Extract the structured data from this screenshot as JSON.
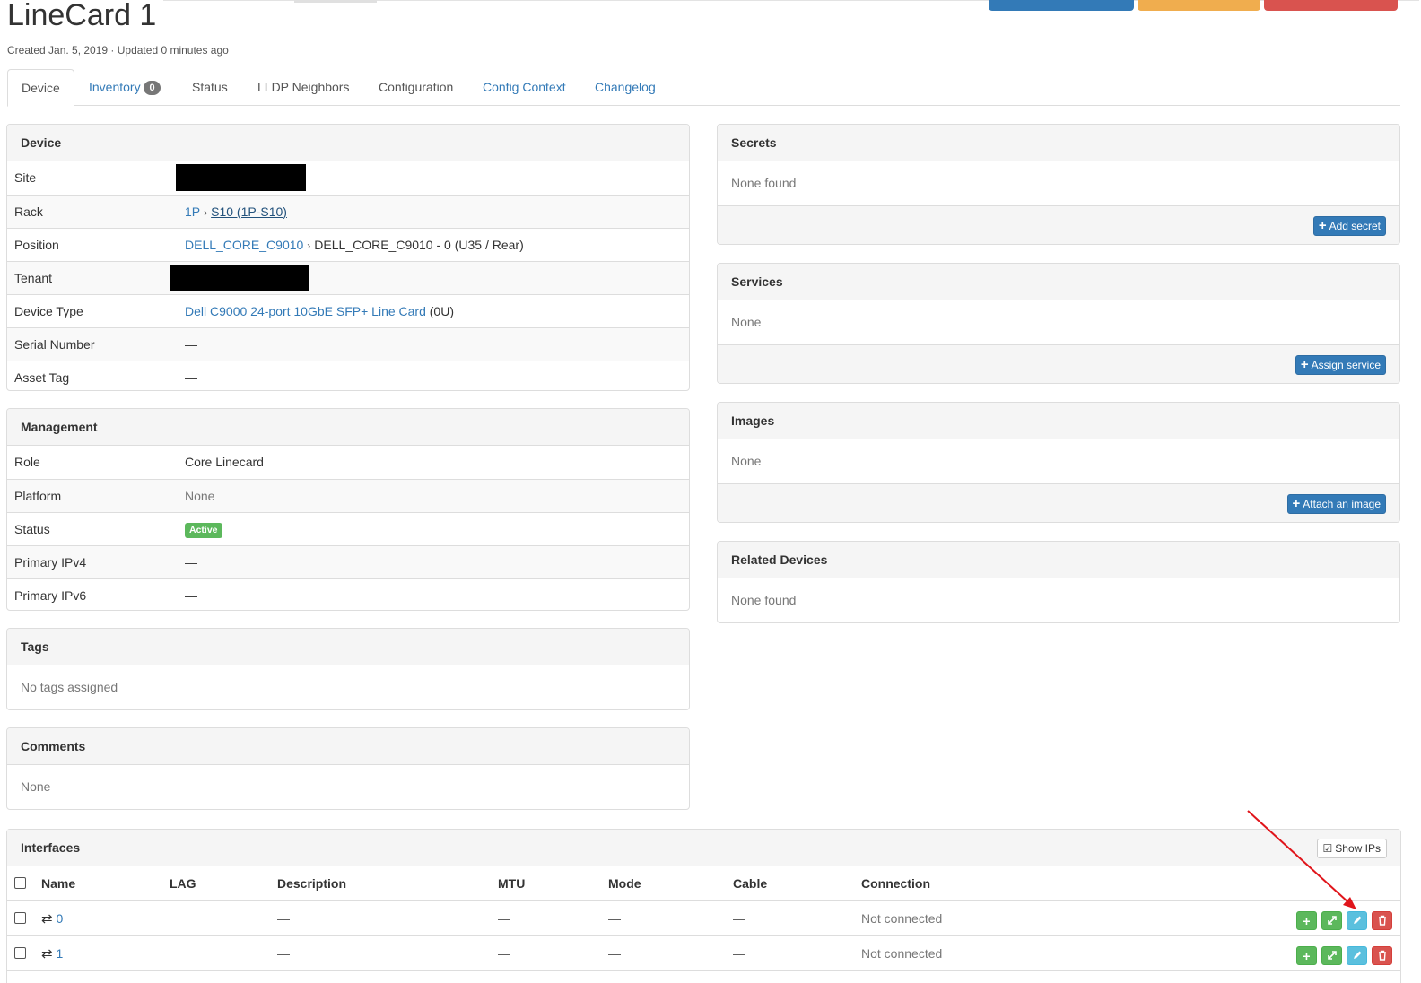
{
  "colors": {
    "primary": "#337ab7",
    "warning": "#f0ad4e",
    "danger": "#d9534f",
    "success": "#5cb85c",
    "info": "#5bc0de",
    "annotation": "#e0151b"
  },
  "title": "LineCard 1",
  "meta": "Created Jan. 5, 2019 · Updated 0 minutes ago",
  "tabs": [
    {
      "label": "Device"
    },
    {
      "label": "Inventory",
      "count": "0"
    },
    {
      "label": "Status"
    },
    {
      "label": "LLDP Neighbors"
    },
    {
      "label": "Configuration"
    },
    {
      "label": "Config Context"
    },
    {
      "label": "Changelog"
    }
  ],
  "device": {
    "heading": "Device",
    "site_label": "Site",
    "rack_label": "Rack",
    "rack_site": "1P",
    "rack_name": "S10 (1P-S10)",
    "position_label": "Position",
    "position_parent": "DELL_CORE_C9010",
    "position_value": "DELL_CORE_C9010 - 0 (U35 / Rear)",
    "tenant_label": "Tenant",
    "type_label": "Device Type",
    "type_link": "Dell C9000 24-port 10GbE SFP+ Line Card",
    "type_suffix": "(0U)",
    "serial_label": "Serial Number",
    "serial_value": "—",
    "asset_label": "Asset Tag",
    "asset_value": "—"
  },
  "management": {
    "heading": "Management",
    "role_label": "Role",
    "role_value": "Core Linecard",
    "platform_label": "Platform",
    "platform_value": "None",
    "status_label": "Status",
    "status_value": "Active",
    "ipv4_label": "Primary IPv4",
    "ipv4_value": "—",
    "ipv6_label": "Primary IPv6",
    "ipv6_value": "—"
  },
  "tags": {
    "heading": "Tags",
    "body": "No tags assigned"
  },
  "comments": {
    "heading": "Comments",
    "body": "None"
  },
  "secrets": {
    "heading": "Secrets",
    "body": "None found",
    "button": "Add secret"
  },
  "services": {
    "heading": "Services",
    "body": "None",
    "button": "Assign service"
  },
  "images": {
    "heading": "Images",
    "body": "None",
    "button": "Attach an image"
  },
  "related": {
    "heading": "Related Devices",
    "body": "None found"
  },
  "interfaces": {
    "heading": "Interfaces",
    "show_ips": "Show IPs",
    "columns": [
      "Name",
      "LAG",
      "Description",
      "MTU",
      "Mode",
      "Cable",
      "Connection"
    ],
    "rows": [
      {
        "name": "0",
        "description": "—",
        "mtu": "—",
        "mode": "—",
        "cable": "—",
        "connection": "Not connected"
      },
      {
        "name": "1",
        "description": "—",
        "mtu": "—",
        "mode": "—",
        "cable": "—",
        "connection": "Not connected"
      }
    ]
  }
}
